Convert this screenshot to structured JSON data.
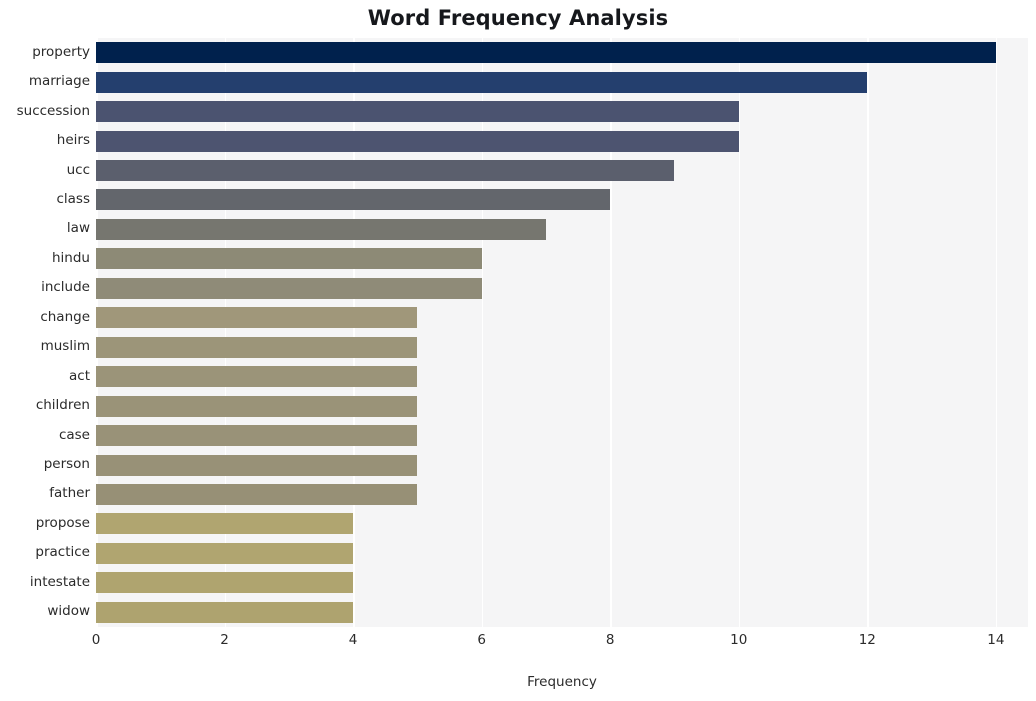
{
  "chart_data": {
    "type": "bar",
    "orientation": "horizontal",
    "title": "Word Frequency Analysis",
    "xlabel": "Frequency",
    "ylabel": "",
    "categories": [
      "property",
      "marriage",
      "succession",
      "heirs",
      "ucc",
      "class",
      "law",
      "hindu",
      "include",
      "change",
      "muslim",
      "act",
      "children",
      "case",
      "person",
      "father",
      "propose",
      "practice",
      "intestate",
      "widow"
    ],
    "values": [
      14,
      12,
      10,
      10,
      9,
      8,
      7,
      6,
      6,
      5,
      5,
      5,
      5,
      5,
      5,
      5,
      4,
      4,
      4,
      4
    ],
    "xticks": [
      0,
      2,
      4,
      6,
      8,
      10,
      12,
      14
    ],
    "xlim": [
      0,
      14.5
    ],
    "grid": "vertical-white",
    "legend": null,
    "bar_colors": [
      "#00214d",
      "#243f6e",
      "#4b5370",
      "#4d5470",
      "#5b5f6d",
      "#63666c",
      "#76766f",
      "#8d8a76",
      "#8f8b78",
      "#a0977a",
      "#9c9579",
      "#9b9479",
      "#9a9378",
      "#999278",
      "#989177",
      "#979076",
      "#b0a570",
      "#b0a570",
      "#afa46f",
      "#aea36f"
    ],
    "plot_background": "#f5f5f6",
    "gridline_color": "#ffffff",
    "text_color": "#2b2b2b"
  }
}
